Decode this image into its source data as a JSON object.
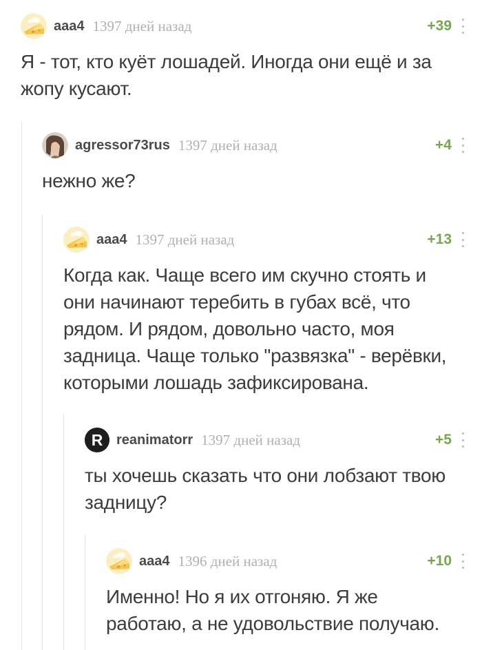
{
  "comments": [
    {
      "username": "aaa4",
      "time": "1397 дней назад",
      "rating": "+39",
      "avatar": "cheese-icon",
      "text": "Я - тот, кто куёт лошадей. Иногда они ещё и за жопу кусают."
    },
    {
      "username": "agressor73rus",
      "time": "1397 дней назад",
      "rating": "+4",
      "avatar": "user-photo",
      "text": "нежно же?"
    },
    {
      "username": "aaa4",
      "time": "1397 дней назад",
      "rating": "+13",
      "avatar": "cheese-icon",
      "text": "Когда как. Чаще всего им скучно стоять и они начинают теребить в губах всё, что рядом. И рядом, довольно часто, моя задница. Чаще только \"развязка\" - верёвки, которыми лошадь зафиксирована."
    },
    {
      "username": "reanimatorr",
      "time": "1397 дней назад",
      "rating": "+5",
      "avatar": "letter-r",
      "text": "ты хочешь сказать что они лобзают твою задницу?"
    },
    {
      "username": "aaa4",
      "time": "1396 дней назад",
      "rating": "+10",
      "avatar": "cheese-icon",
      "text": "Именно! Но я их отгоняю. Я же работаю, а не удовольствие получаю."
    }
  ],
  "avatar_letter": "R",
  "colors": {
    "rating": "#74a84a",
    "timestamp": "#b0b0b0",
    "username": "#4a4a4a",
    "text": "#3c3c3c",
    "thread_line": "#e2e2e2"
  }
}
